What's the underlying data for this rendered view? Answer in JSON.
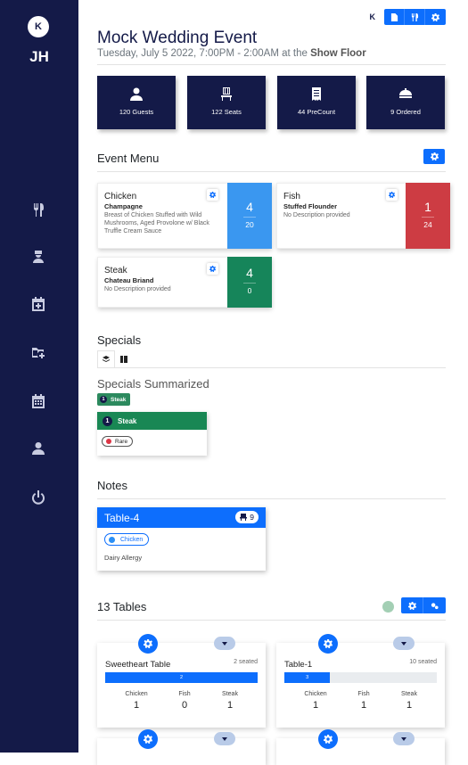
{
  "user": {
    "logo_text": "K",
    "initials": "JH"
  },
  "sidebar": {
    "items": [
      {
        "icon": "utensils-icon"
      },
      {
        "icon": "chef-icon"
      },
      {
        "icon": "calendar-plus-icon"
      },
      {
        "icon": "folder-plus-icon"
      },
      {
        "icon": "calendar-icon"
      },
      {
        "icon": "user-icon"
      },
      {
        "icon": "power-icon"
      }
    ]
  },
  "header": {
    "brand_mini": "K",
    "title": "Mock Wedding Event",
    "subtitle_prefix": "Tuesday, July 5 2022, 7:00PM - 2:00AM at the ",
    "subtitle_venue": "Show Floor"
  },
  "stats": [
    {
      "icon": "guests-icon",
      "label": "120 Guests"
    },
    {
      "icon": "seat-icon",
      "label": "122 Seats"
    },
    {
      "icon": "receipt-icon",
      "label": "44 PreCount"
    },
    {
      "icon": "bell-icon",
      "label": "9 Ordered"
    }
  ],
  "event_menu": {
    "heading": "Event Menu",
    "items": [
      {
        "name": "Chicken",
        "sub": "Champagne",
        "desc": "Breast of Chicken Stuffed with Wild Mushrooms, Aged Provolone w/ Black Truffle Cream Sauce",
        "count": "4",
        "total": "20",
        "color": "#3a97f0"
      },
      {
        "name": "Fish",
        "sub": "Stuffed Flounder",
        "desc": "No Description provided",
        "count": "1",
        "total": "24",
        "color": "#cd3c43"
      },
      {
        "name": "Steak",
        "sub": "Chateau Briand",
        "desc": "No Description provided",
        "count": "4",
        "total": "0",
        "color": "#16855a"
      }
    ]
  },
  "specials": {
    "heading": "Specials",
    "summary_heading": "Specials Summarized",
    "summary_pill": {
      "num": "1",
      "label": "Steak"
    },
    "card": {
      "num": "1",
      "label": "Steak",
      "tag": "Rare"
    }
  },
  "notes": {
    "heading": "Notes",
    "card": {
      "table": "Table-4",
      "seats": "9",
      "tag": "Chicken",
      "text": "Dairy Allergy"
    }
  },
  "tables": {
    "heading": "13 Tables",
    "cols": [
      "Chicken",
      "Fish",
      "Steak"
    ],
    "items": [
      {
        "name": "Sweetheart Table",
        "seated": "2 seated",
        "bar_label": "2",
        "bar_fraction": 1.0,
        "values": [
          "1",
          "0",
          "1"
        ]
      },
      {
        "name": "Table-1",
        "seated": "10 seated",
        "bar_label": "3",
        "bar_fraction": 0.3,
        "values": [
          "1",
          "1",
          "1"
        ]
      }
    ]
  }
}
